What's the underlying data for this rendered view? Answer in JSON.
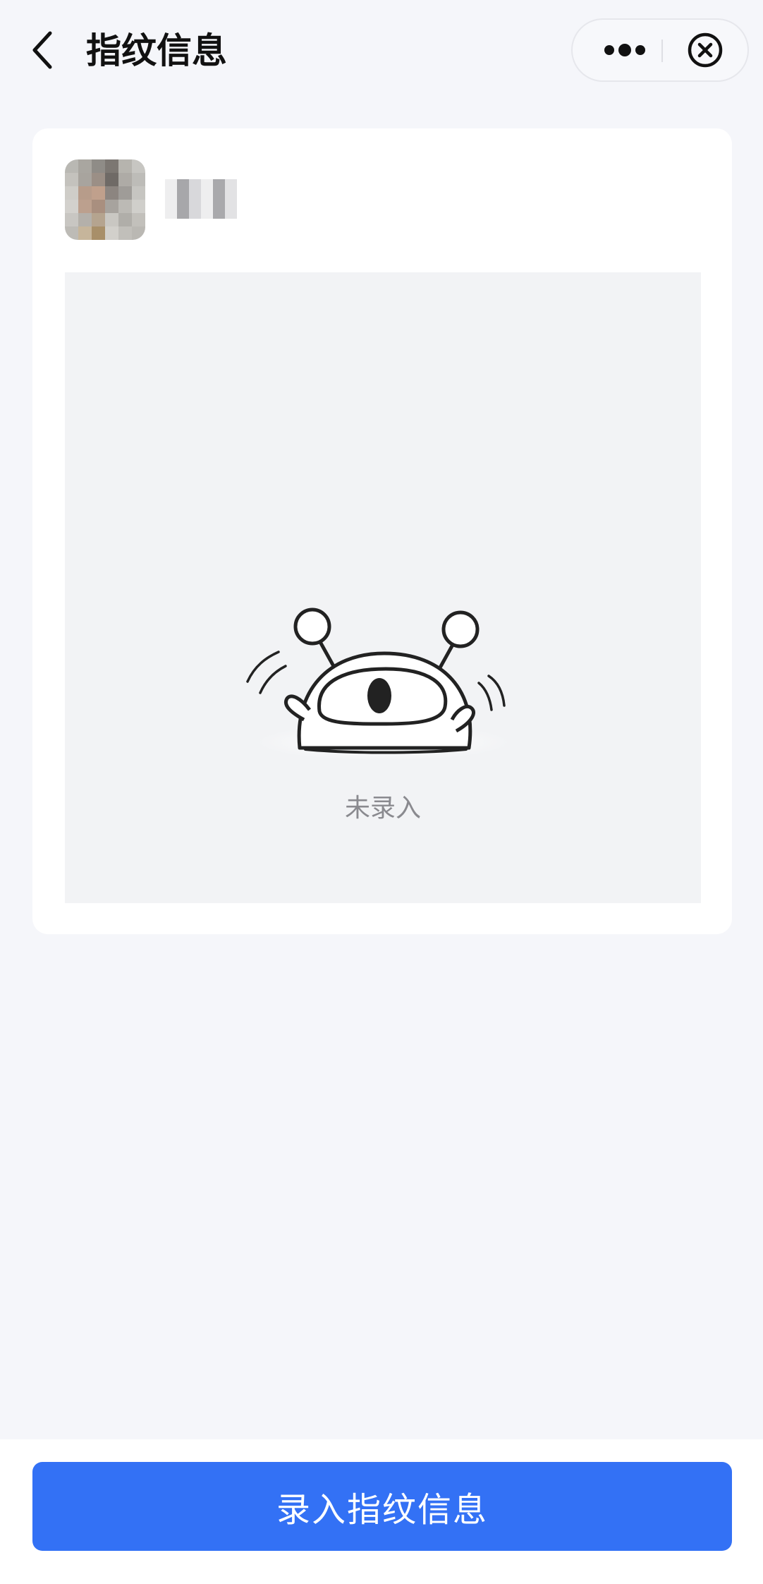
{
  "header": {
    "title": "指纹信息",
    "back_icon": "chevron-left-icon",
    "more_icon": "more-dots-icon",
    "close_icon": "close-circle-icon"
  },
  "profile": {
    "avatar": "avatar-image",
    "name_blurred": true
  },
  "empty_state": {
    "illustration": "mascot-peeking-illustration",
    "text": "未录入"
  },
  "footer": {
    "enroll_label": "录入指纹信息"
  },
  "colors": {
    "primary": "#3371f5",
    "background": "#f5f6fa",
    "panel": "#f2f3f5",
    "title": "#111111",
    "muted_text": "#8a8a8f"
  }
}
